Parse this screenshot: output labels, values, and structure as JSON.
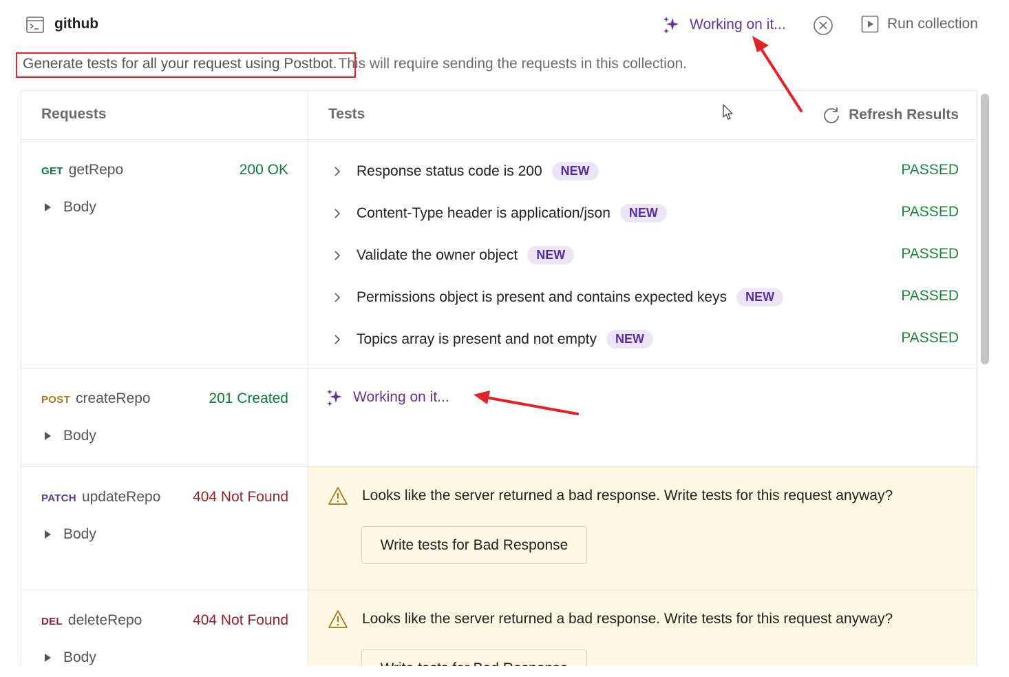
{
  "header": {
    "collection_name": "github",
    "working_label": "Working on it...",
    "run_label": "Run collection"
  },
  "description": {
    "highlighted": "Generate tests for all your request using Postbot.",
    "rest": "This will require sending the requests in this collection."
  },
  "table": {
    "requests_header": "Requests",
    "tests_header": "Tests",
    "refresh_label": "Refresh Results"
  },
  "requests": [
    {
      "method": "GET",
      "name": "getRepo",
      "status": "200 OK",
      "body_label": "Body",
      "tests": [
        {
          "name": "Response status code is 200",
          "badge": "NEW",
          "result": "PASSED"
        },
        {
          "name": "Content-Type header is application/json",
          "badge": "NEW",
          "result": "PASSED"
        },
        {
          "name": "Validate the owner object",
          "badge": "NEW",
          "result": "PASSED"
        },
        {
          "name": "Permissions object is present and contains expected keys",
          "badge": "NEW",
          "result": "PASSED"
        },
        {
          "name": "Topics array is present and not empty",
          "badge": "NEW",
          "result": "PASSED"
        }
      ]
    },
    {
      "method": "POST",
      "name": "createRepo",
      "status": "201 Created",
      "body_label": "Body",
      "working_label": "Working on it..."
    },
    {
      "method": "PATCH",
      "name": "updateRepo",
      "status": "404 Not Found",
      "body_label": "Body",
      "warning": "Looks like the server returned a bad response. Write tests for this request anyway?",
      "button_label": "Write tests for Bad Response"
    },
    {
      "method": "DEL",
      "name": "deleteRepo",
      "status": "404 Not Found",
      "body_label": "Body",
      "warning": "Looks like the server returned a bad response. Write tests for this request anyway?",
      "button_label": "Write tests for Bad Response"
    }
  ],
  "colors": {
    "accent": "#623497",
    "passed": "#1e8040",
    "error": "#8e2430",
    "warning_bg": "#fdf8e3",
    "annotation": "#e0232a"
  }
}
